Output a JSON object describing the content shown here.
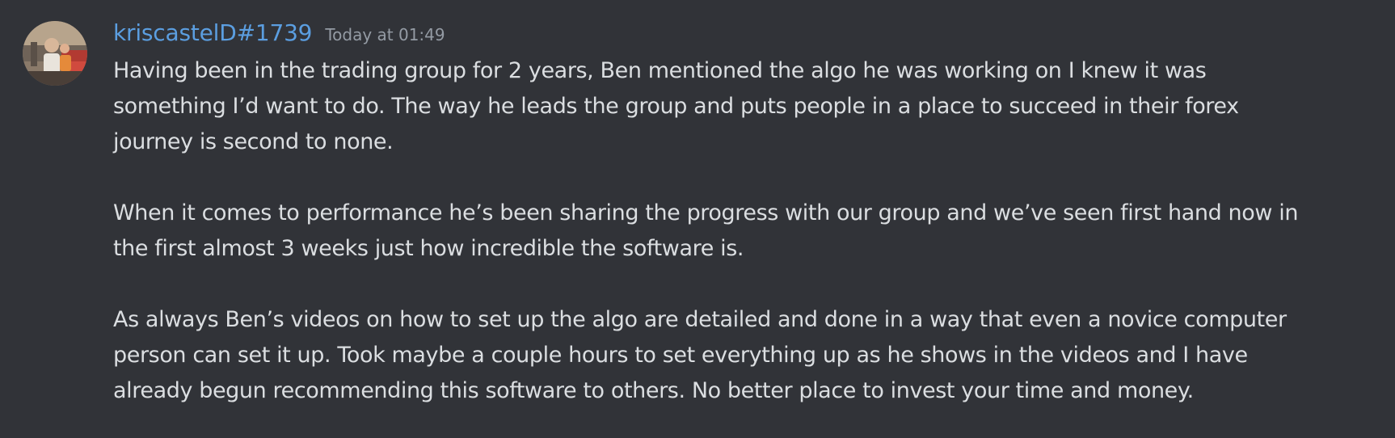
{
  "message": {
    "author": {
      "username": "kriscastelD#1739",
      "name_color": "#5b9ee0",
      "avatar_icon": "user-avatar-photo"
    },
    "timestamp": "Today at 01:49",
    "paragraphs": [
      "Having been in the trading group for 2 years, Ben mentioned the algo he was working on I knew it was\nsomething I’d want to do. The way he leads the group and puts people in a place to succeed in their forex\njourney is second to none.",
      "When it comes to performance he’s been sharing the progress with our group and we’ve seen first hand now in\nthe first almost 3 weeks just how incredible the software is.",
      "As always Ben’s videos on how to set up the algo are detailed and done in a way that even a novice computer\nperson can set it up. Took maybe a couple hours to set everything up as he shows in the videos and I have\nalready begun recommending this software to others. No better place to invest your time and money."
    ]
  },
  "theme": {
    "background": "#313338",
    "text": "#dbdee1",
    "muted": "#949ba4"
  }
}
